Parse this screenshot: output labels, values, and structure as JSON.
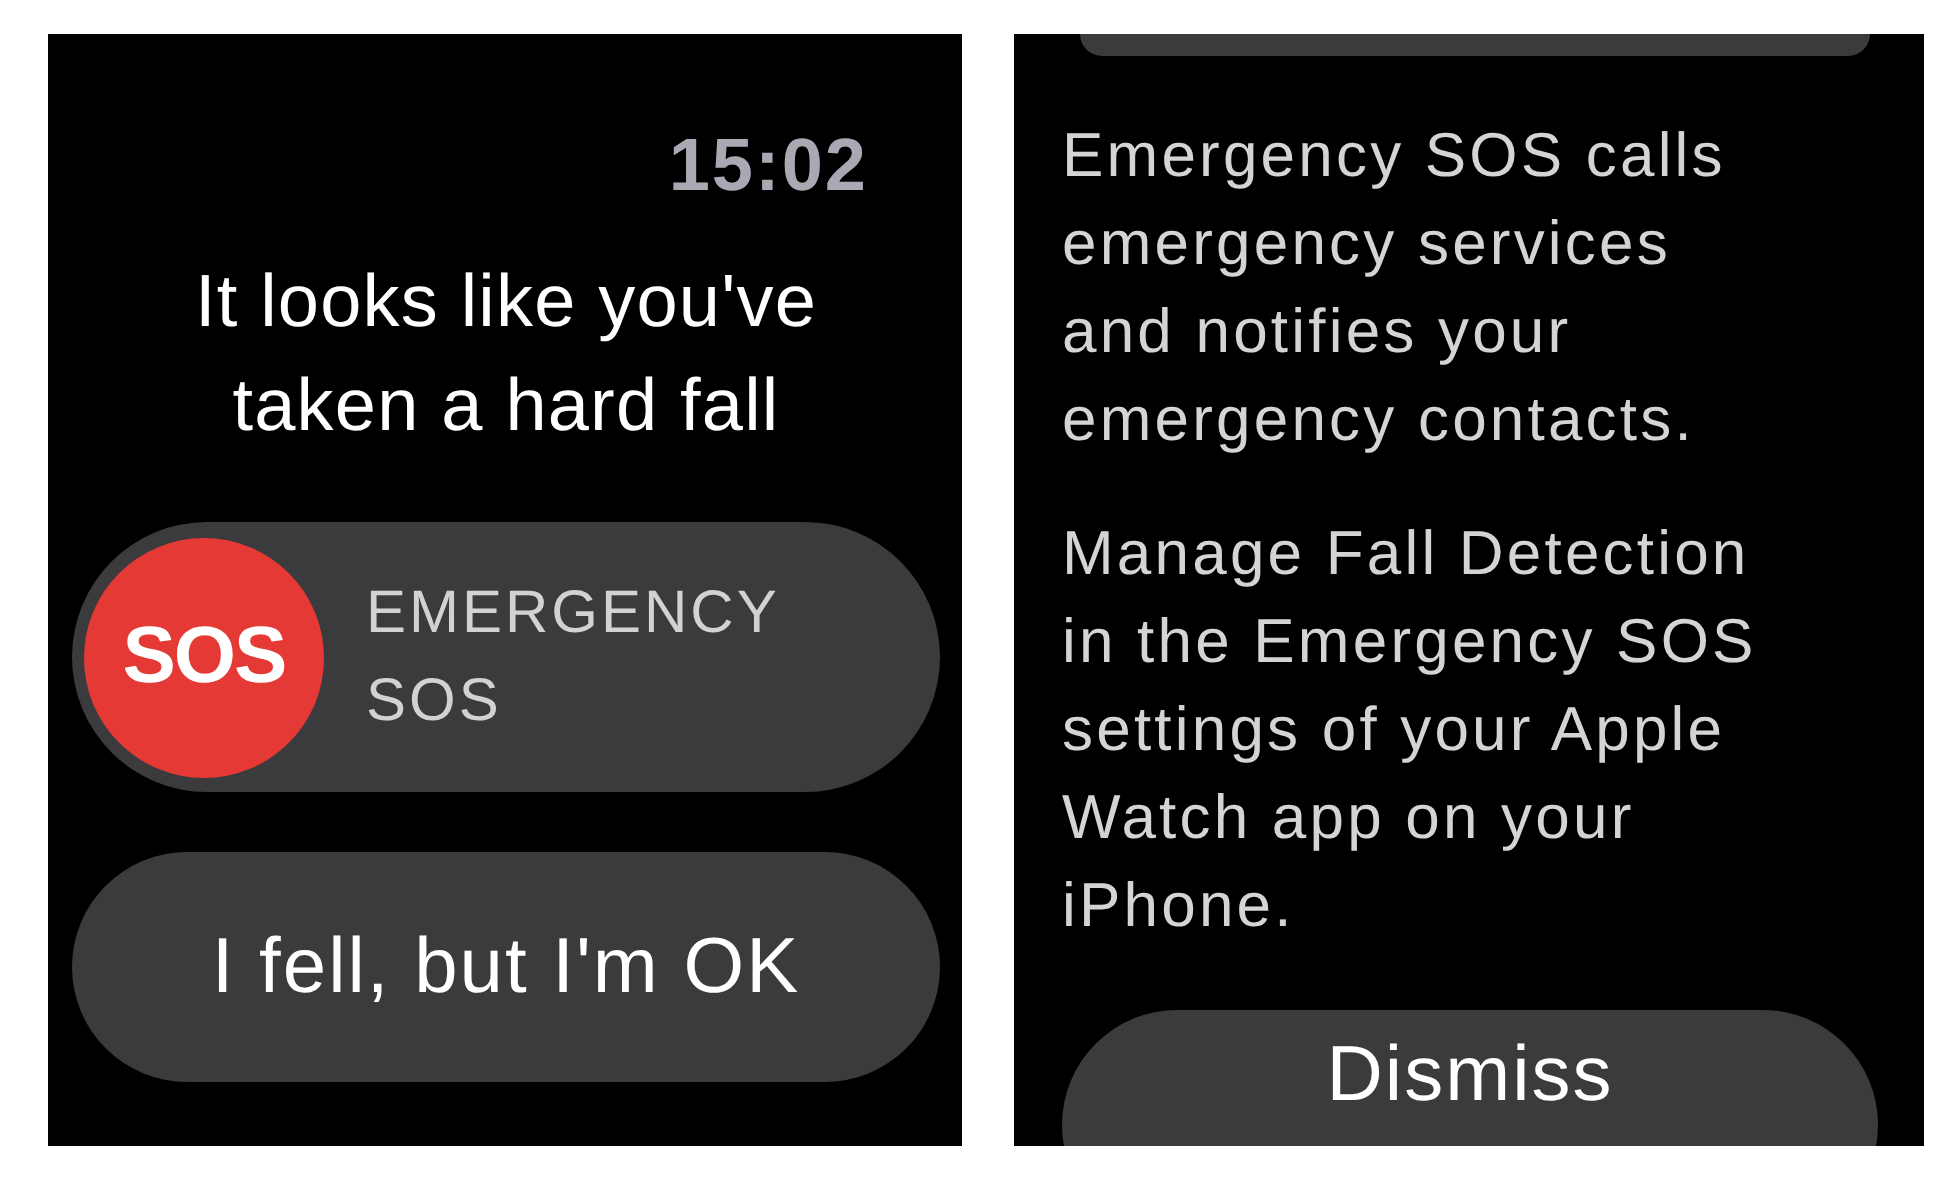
{
  "left_screen": {
    "time": "15:02",
    "title": "It looks like you've taken a hard fall",
    "sos_slider": {
      "badge": "SOS",
      "label": "EMERGENCY SOS",
      "level": 0
    },
    "ok_button": "I fell, but I'm OK"
  },
  "right_screen": {
    "paragraphs": [
      "Emergency SOS calls emergency services and notifies your emergency contacts.",
      "Manage Fall Detection in the Emergency SOS settings of your Apple Watch app on your iPhone."
    ],
    "dismiss_button": "Dismiss"
  }
}
